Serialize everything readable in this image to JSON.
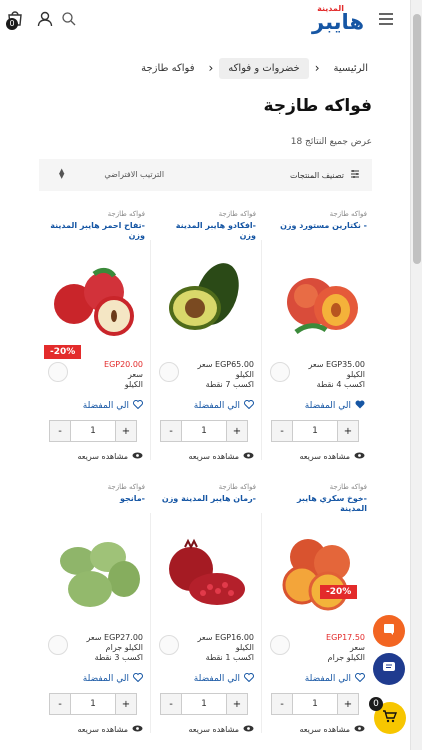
{
  "header": {
    "cart_count": "0",
    "logo_small": "المدينة",
    "logo_big": "هايبر"
  },
  "breadcrumb": {
    "home": "الرئيسية",
    "category": "خضروات و فواكه",
    "current": "فواكه طازجة"
  },
  "page_title": "فواكه طازجة",
  "results_text": "عرض جميع النتائج 18",
  "filter": {
    "classify": "تصنيف المنتجات",
    "sort": "الترتيب الافتراضي"
  },
  "product_labels": {
    "wishlist": "الي المفضلة",
    "quick_view": "مشاهده سريعه",
    "qty": "1",
    "minus": "-",
    "plus": "+"
  },
  "products": [
    {
      "category": "فواكه طازجة",
      "name": "- نكتارين مستورد وزن",
      "price": "EGP35.00 سعر",
      "unit": "الكيلو",
      "points": "اكسب 4 نقطة",
      "sale": "",
      "fav_color": "#1656a4"
    },
    {
      "category": "فواكه طازجة",
      "name": "-افكادو هايبر المدينة وزن",
      "price": "EGP65.00 سعر",
      "unit": "الكيلو",
      "points": "اكسب 7 نقطة",
      "sale": "",
      "fav_color": "#1656a4"
    },
    {
      "category": "فواكه طازجة",
      "name": "-تفاح احمر هايبر المدينة وزن",
      "price": "EGP20.00",
      "price_prefix": "سعر",
      "unit": "الكيلو",
      "points": "",
      "sale": "-20%",
      "fav_color": "#1656a4"
    },
    {
      "category": "فواكه طازجة",
      "name": "-خوخ سكري هايبر المدينة",
      "price": "EGP17.50",
      "price_prefix": "سعر",
      "unit": "الكيلو جرام",
      "points": "",
      "sale": "-20%",
      "fav_color": "#1656a4"
    },
    {
      "category": "فواكه طازجة",
      "name": "-رمان هايبر المدينة وزن",
      "price": "EGP16.00 سعر",
      "unit": "الكيلو",
      "points": "اكسب 1 نقطة",
      "sale": "",
      "fav_color": "#1656a4"
    },
    {
      "category": "فواكه طازجة",
      "name": "-مانجو",
      "price": "EGP27.00 سعر",
      "unit": "الكيلو جرام",
      "points": "اكسب 3 نقطة",
      "sale": "",
      "fav_color": "#1656a4"
    }
  ],
  "floating": {
    "cart_count": "0"
  },
  "colors": {
    "brand_blue": "#1656a4",
    "brand_red": "#e32b2b",
    "sale_red": "#e32b2b",
    "chat_orange": "#f26522",
    "chat_blue": "#1f3b8f",
    "cart_yellow": "#f7c600"
  }
}
